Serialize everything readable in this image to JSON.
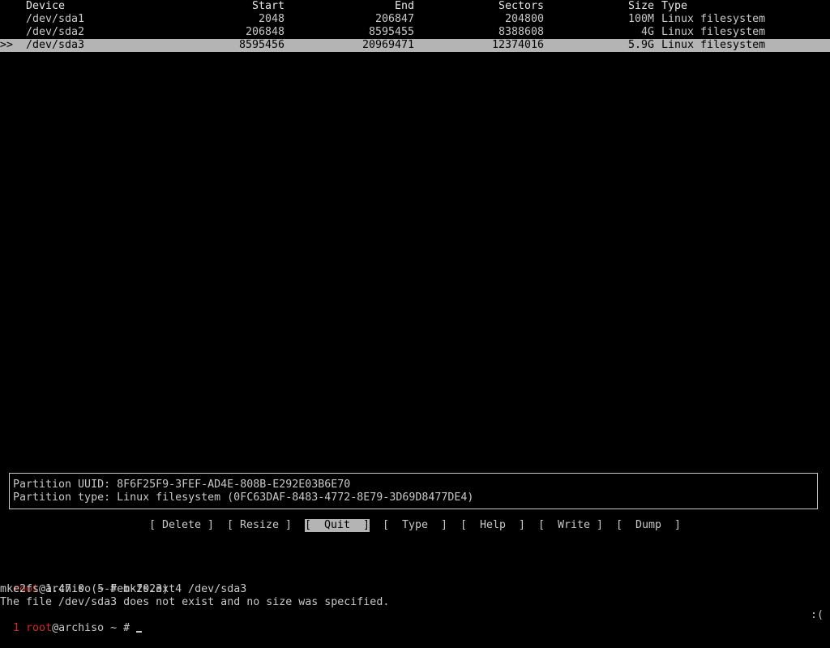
{
  "table": {
    "headers": {
      "device": "Device",
      "start": "Start",
      "end": "End",
      "sectors": "Sectors",
      "size": "Size",
      "type": "Type"
    },
    "rows": [
      {
        "marker": "",
        "device": "/dev/sda1",
        "start": "2048",
        "end": "206847",
        "sectors": "204800",
        "size": "100M",
        "type": "Linux filesystem"
      },
      {
        "marker": "",
        "device": "/dev/sda2",
        "start": "206848",
        "end": "8595455",
        "sectors": "8388608",
        "size": "4G",
        "type": "Linux filesystem"
      },
      {
        "marker": ">>",
        "device": "/dev/sda3",
        "start": "8595456",
        "end": "20969471",
        "sectors": "12374016",
        "size": "5.9G",
        "type": "Linux filesystem"
      }
    ],
    "selected_row": 2
  },
  "info": {
    "uuid_line": "Partition UUID: 8F6F25F9-3FEF-AD4E-808B-E292E03B6E70",
    "type_line": "Partition type: Linux filesystem (0FC63DAF-8483-4772-8E79-3D69D8477DE4)"
  },
  "menu": {
    "delete": "[ Delete ]",
    "resize": "[ Resize ]",
    "quit": "[  Quit  ]",
    "type": "[  Type  ]",
    "help": "[  Help  ]",
    "write": "[  Write ]",
    "dump": "[  Dump  ]",
    "active": "quit"
  },
  "terminal": {
    "line1_user": "root",
    "line1_rest": "@archiso ~ # mkfs.ext4 /dev/sda3",
    "line2": "mke2fs 1.47.0 (5-Feb-2023)",
    "line3": "The file /dev/sda3 does not exist and no size was specified.",
    "line4_status": "1",
    "line4_user": "root",
    "line4_rest": "@archiso ~ # ",
    "right_status": ":("
  },
  "colors": {
    "background": "#000000",
    "foreground": "#c8c8c8",
    "selection": "#b4b4b4",
    "prompt_red": "#d22828"
  }
}
